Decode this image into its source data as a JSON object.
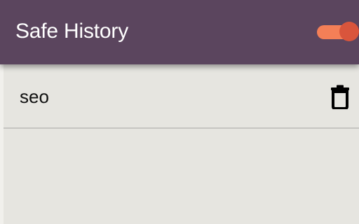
{
  "header": {
    "title": "Safe History",
    "toggle_on": true,
    "toggle_track_color": "#f47f57",
    "toggle_knob_color": "#d9553c",
    "background_color": "#5b455e"
  },
  "history": {
    "items": [
      {
        "label": "seo",
        "action_icon": "trash-icon"
      }
    ]
  }
}
